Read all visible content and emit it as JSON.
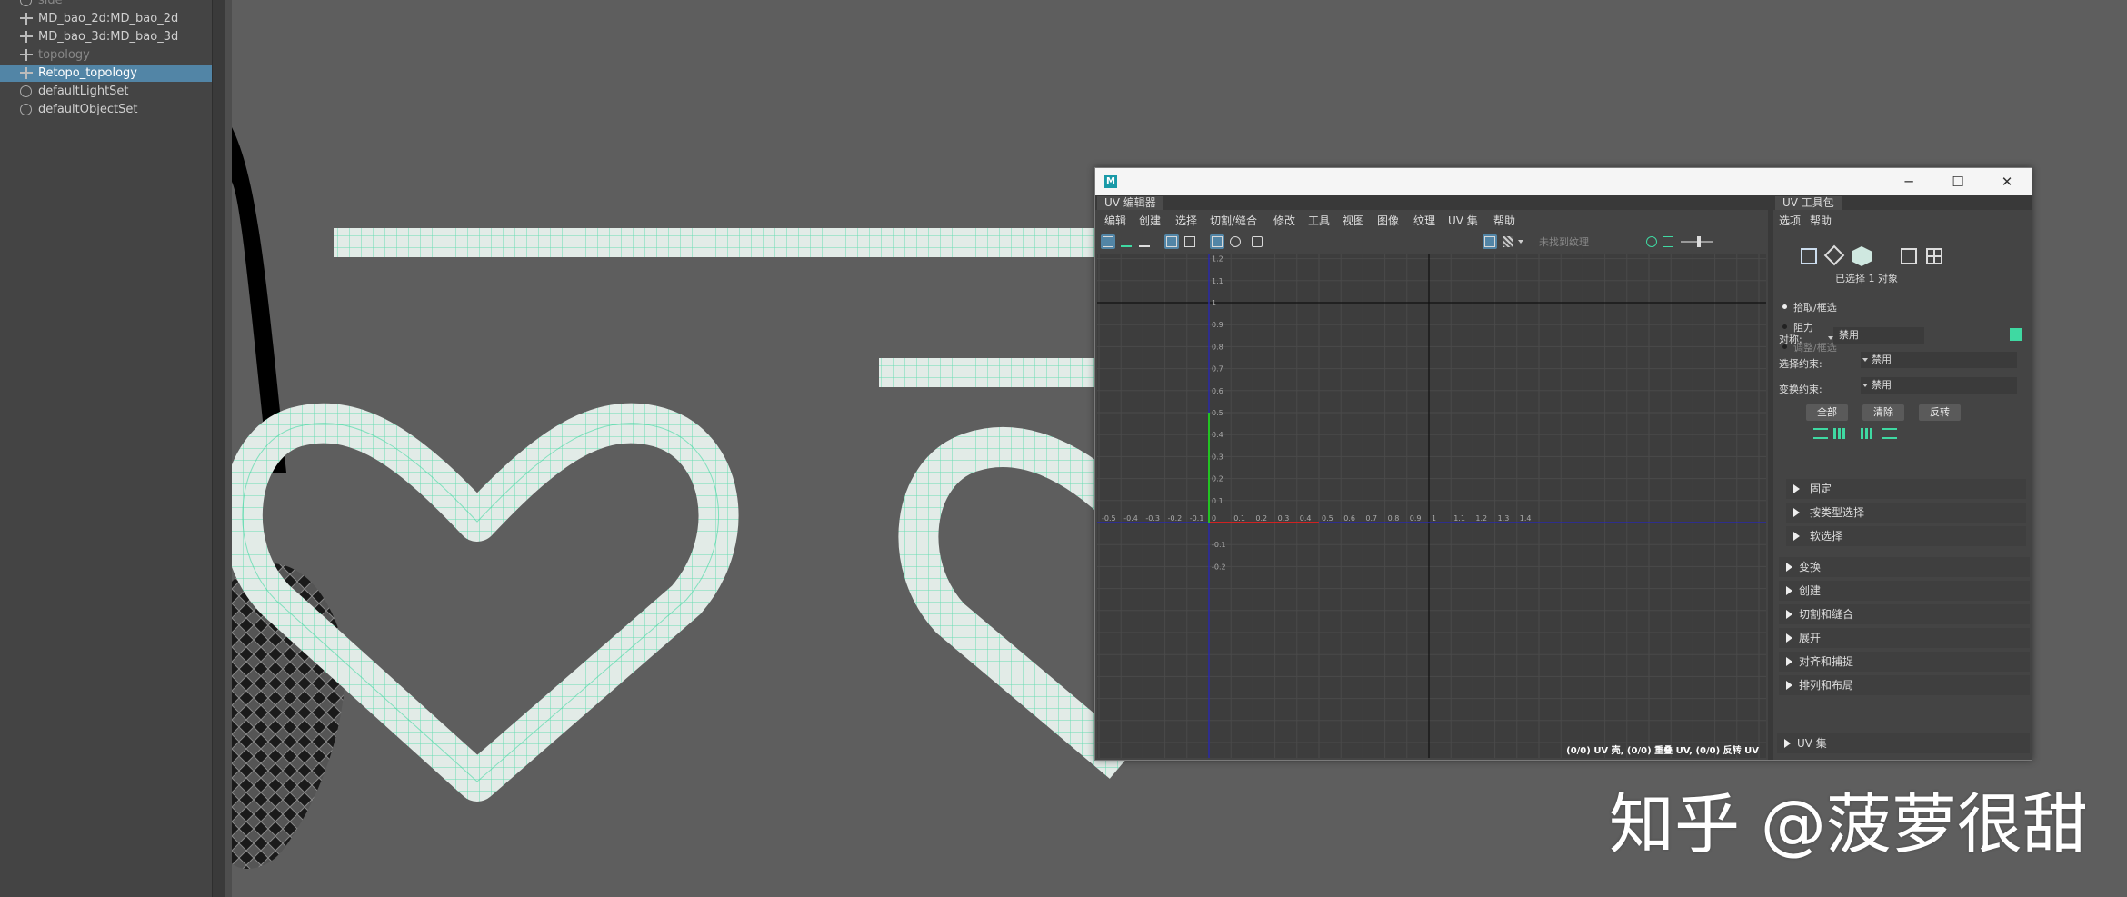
{
  "outliner": {
    "items": [
      {
        "label": "side",
        "dim": true,
        "selected": false,
        "icon": "set-icon"
      },
      {
        "label": "MD_bao_2d:MD_bao_2d",
        "dim": false,
        "selected": false,
        "icon": "group-icon"
      },
      {
        "label": "MD_bao_3d:MD_bao_3d",
        "dim": false,
        "selected": false,
        "icon": "group-icon"
      },
      {
        "label": "topology",
        "dim": true,
        "selected": false,
        "icon": "group-icon"
      },
      {
        "label": "Retopo_topology",
        "dim": false,
        "selected": true,
        "icon": "group-icon"
      },
      {
        "label": "defaultLightSet",
        "dim": false,
        "selected": false,
        "icon": "set-icon"
      },
      {
        "label": "defaultObjectSet",
        "dim": false,
        "selected": false,
        "icon": "set-icon"
      }
    ]
  },
  "uv_window": {
    "logo": "M",
    "editor_tab": "UV 编辑器",
    "menus": [
      "编辑",
      "创建",
      "选择",
      "切割/缝合",
      "修改",
      "工具",
      "视图",
      "图像",
      "纹理",
      "UV 集",
      "帮助"
    ],
    "no_texture": "未找到纹理",
    "axis_labels": {
      "x": [
        "-0.5",
        "-0.4",
        "-0.3",
        "-0.2",
        "-0.1",
        "0",
        "0.1",
        "0.2",
        "0.3",
        "0.4",
        "0.5",
        "0.6",
        "0.7",
        "0.8",
        "0.9",
        "1",
        "1.1",
        "1.2",
        "1.3",
        "1.4"
      ],
      "y": [
        "1.2",
        "1.1",
        "1",
        "0.9",
        "0.8",
        "0.7",
        "0.6",
        "0.5",
        "0.4",
        "0.3",
        "0.2",
        "0.1",
        "-0.1",
        "-0.2"
      ]
    },
    "status": "(0/0) UV 壳, (0/0) 重叠 UV, (0/0) 反转 UV"
  },
  "toolkit": {
    "tab": "UV 工具包",
    "menus": [
      "选项",
      "帮助"
    ],
    "selected_count": "已选择 1 对象",
    "modes": [
      {
        "label": "拾取/框选",
        "active": true
      },
      {
        "label": "阻力",
        "active": false
      },
      {
        "label": "调整/框选",
        "active": false,
        "dim": true
      }
    ],
    "symmetry_label": "对称:",
    "symmetry_value": "禁用",
    "select_constraint_label": "选择约束:",
    "select_constraint_value": "禁用",
    "transform_constraint_label": "变换约束:",
    "transform_constraint_value": "禁用",
    "buttons": [
      "全部",
      "清除",
      "反转"
    ],
    "subsections": [
      "固定",
      "按类型选择",
      "软选择"
    ],
    "sections": [
      "变换",
      "创建",
      "切割和缝合",
      "展开",
      "对齐和捕捉",
      "排列和布局"
    ],
    "uvset_section": "UV 集"
  },
  "colors": {
    "uv_mesh_fill": "#e2ebe7",
    "uv_mesh_wire": "#3fd9a2",
    "selection": "#5285a6",
    "u_axis": "#d02222",
    "v_axis": "#22c322"
  },
  "watermark": "知乎 @菠萝很甜"
}
